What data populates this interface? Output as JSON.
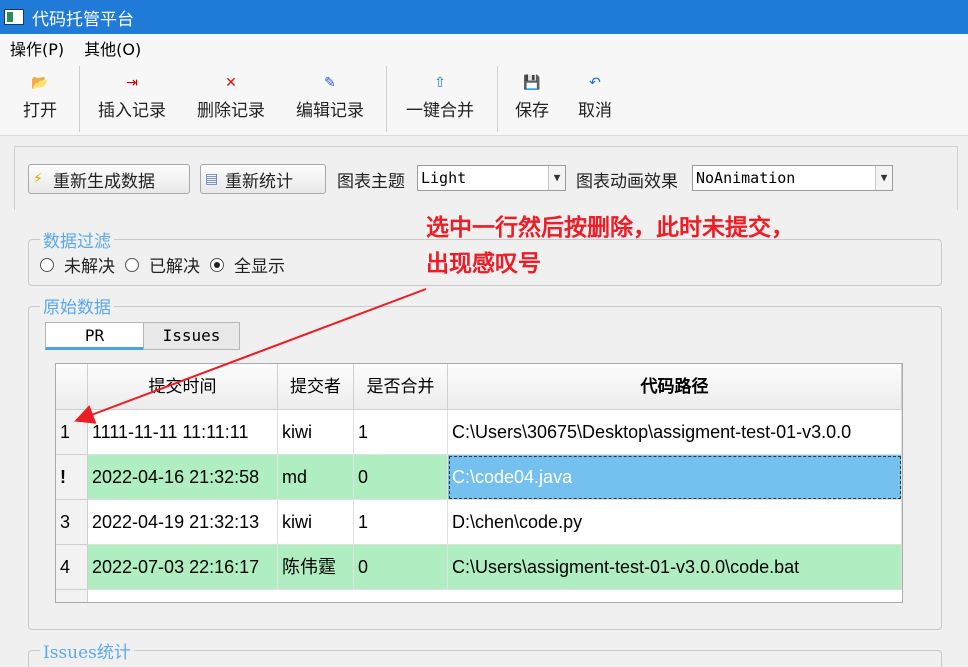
{
  "window": {
    "title": "代码托管平台"
  },
  "menu": {
    "items": [
      "操作(P)",
      "其他(O)"
    ]
  },
  "toolbar": {
    "open": "打开",
    "insert": "插入记录",
    "delete": "删除记录",
    "edit": "编辑记录",
    "merge": "一键合并",
    "save": "保存",
    "cancel": "取消"
  },
  "controls": {
    "regen_label": "重新生成数据",
    "restat_label": "重新统计",
    "theme_label": "图表主题",
    "theme_value": "Light",
    "anim_label": "图表动画效果",
    "anim_value": "NoAnimation"
  },
  "filter": {
    "title": "数据过滤",
    "options": [
      "未解决",
      "已解决",
      "全显示"
    ],
    "selected": "全显示"
  },
  "raw": {
    "title": "原始数据",
    "tabs": [
      "PR",
      "Issues"
    ],
    "active_tab": "PR"
  },
  "table": {
    "columns": [
      "提交时间",
      "提交者",
      "是否合并",
      "代码路径"
    ],
    "rows": [
      {
        "header": "1",
        "time": "1111-11-11 11:11:11",
        "author": "kiwi",
        "merged": "1",
        "path": "C:\\Users\\30675\\Desktop\\assigment-test-01-v3.0.0"
      },
      {
        "header": "!",
        "time": "2022-04-16 21:32:58",
        "author": "md",
        "merged": "0",
        "path": "C:\\code04.java"
      },
      {
        "header": "3",
        "time": "2022-04-19 21:32:13",
        "author": "kiwi",
        "merged": "1",
        "path": "D:\\chen\\code.py"
      },
      {
        "header": "4",
        "time": "2022-07-03 22:16:17",
        "author": "陈伟霆",
        "merged": "0",
        "path": "C:\\Users\\assigment-test-01-v3.0.0\\code.bat"
      }
    ]
  },
  "issues_stats": {
    "title": "Issues统计"
  },
  "annotation": {
    "line1": "选中一行然后按删除，此时未提交，",
    "line2": "出现感叹号",
    "color": "#ee1c25"
  },
  "colors": {
    "titlebar": "#1f7ad8",
    "row_green": "#aeeec0",
    "row_selected": "#74c1ef",
    "group_title": "#5aa9ec"
  }
}
